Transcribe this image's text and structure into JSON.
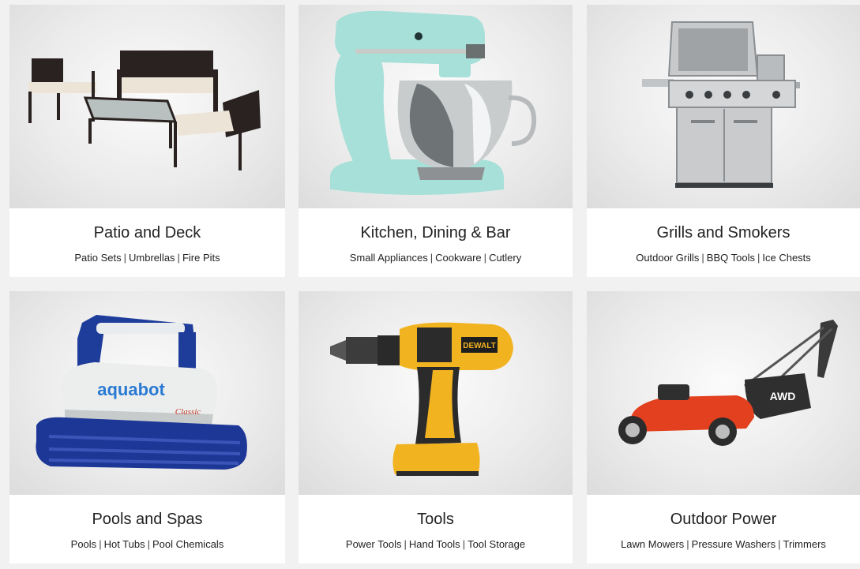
{
  "categories": [
    {
      "title": "Patio and Deck",
      "image_icon": "patio-furniture-icon",
      "links": [
        "Patio Sets",
        "Umbrellas",
        "Fire Pits"
      ]
    },
    {
      "title": "Kitchen, Dining & Bar",
      "image_icon": "stand-mixer-icon",
      "links": [
        "Small Appliances",
        "Cookware",
        "Cutlery"
      ]
    },
    {
      "title": "Grills and Smokers",
      "image_icon": "gas-grill-icon",
      "links": [
        "Outdoor Grills",
        "BBQ Tools",
        "Ice Chests"
      ]
    },
    {
      "title": "Pools and Spas",
      "image_icon": "pool-cleaner-robot-icon",
      "image_text": [
        "aquabot",
        "Classic"
      ],
      "links": [
        "Pools",
        "Hot Tubs",
        "Pool Chemicals"
      ]
    },
    {
      "title": "Tools",
      "image_icon": "power-drill-icon",
      "image_text": [
        "DEWALT"
      ],
      "links": [
        "Power Tools",
        "Hand Tools",
        "Tool Storage"
      ]
    },
    {
      "title": "Outdoor Power",
      "image_icon": "lawn-mower-icon",
      "image_text": [
        "AWD"
      ],
      "links": [
        "Lawn Mowers",
        "Pressure Washers",
        "Trimmers"
      ]
    }
  ],
  "link_separator": "|"
}
